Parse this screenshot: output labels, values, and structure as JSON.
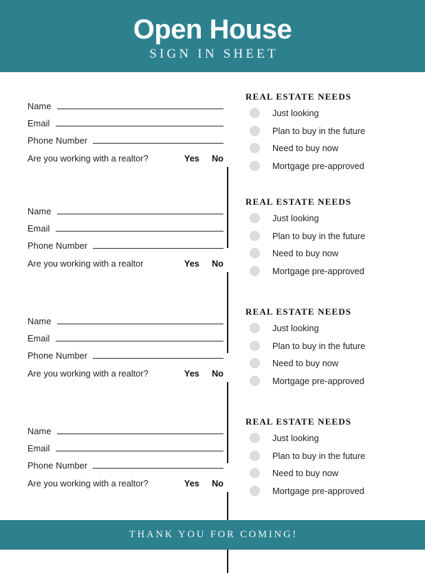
{
  "header": {
    "title": "Open House",
    "subtitle": "SIGN IN SHEET",
    "background_color": "#2d818f",
    "text_color": "#ffffff"
  },
  "footer": {
    "text": "THANK YOU FOR COMING!",
    "background_color": "#2d818f",
    "text_color": "#f3f7f8"
  },
  "labels": {
    "name": "Name",
    "email": "Email",
    "phone": "Phone Number",
    "yes": "Yes",
    "no": "No",
    "needs_title": "REAL ESTATE NEEDS"
  },
  "needs_options": [
    "Just looking",
    "Plan to buy in the future",
    "Need to buy now",
    "Mortgage pre-approved"
  ],
  "dot_color": "#dcdcdc",
  "line_color": "#2a2a2a",
  "blocks": [
    {
      "name_label": "Name",
      "email_label": "Email",
      "phone_label": "Phone Number",
      "realtor_question": "Are you working with a realtor?",
      "yes": "Yes",
      "no": "No",
      "needs_title": "REAL ESTATE NEEDS",
      "needs": [
        "Just looking",
        "Plan to buy in the future",
        "Need to buy now",
        "Mortgage pre-approved"
      ]
    },
    {
      "name_label": "Name",
      "email_label": "Email",
      "phone_label": "Phone Number",
      "realtor_question": "Are you working with a realtor",
      "yes": "Yes",
      "no": "No",
      "needs_title": "REAL ESTATE NEEDS",
      "needs": [
        "Just looking",
        "Plan to buy in the future",
        "Need to buy now",
        "Mortgage pre-approved"
      ]
    },
    {
      "name_label": "Name",
      "email_label": "Email",
      "phone_label": "Phone Number",
      "realtor_question": "Are you working with a realtor?",
      "yes": "Yes",
      "no": "No",
      "needs_title": "REAL ESTATE NEEDS",
      "needs": [
        "Just looking",
        "Plan to buy in the future",
        "Need to buy now",
        "Mortgage pre-approved"
      ]
    },
    {
      "name_label": "Name",
      "email_label": "Email",
      "phone_label": "Phone Number",
      "realtor_question": "Are you working with a realtor?",
      "yes": "Yes",
      "no": "No",
      "needs_title": "REAL ESTATE NEEDS",
      "needs": [
        "Just looking",
        "Plan to buy in the future",
        "Need to buy now",
        "Mortgage pre-approved"
      ]
    }
  ]
}
